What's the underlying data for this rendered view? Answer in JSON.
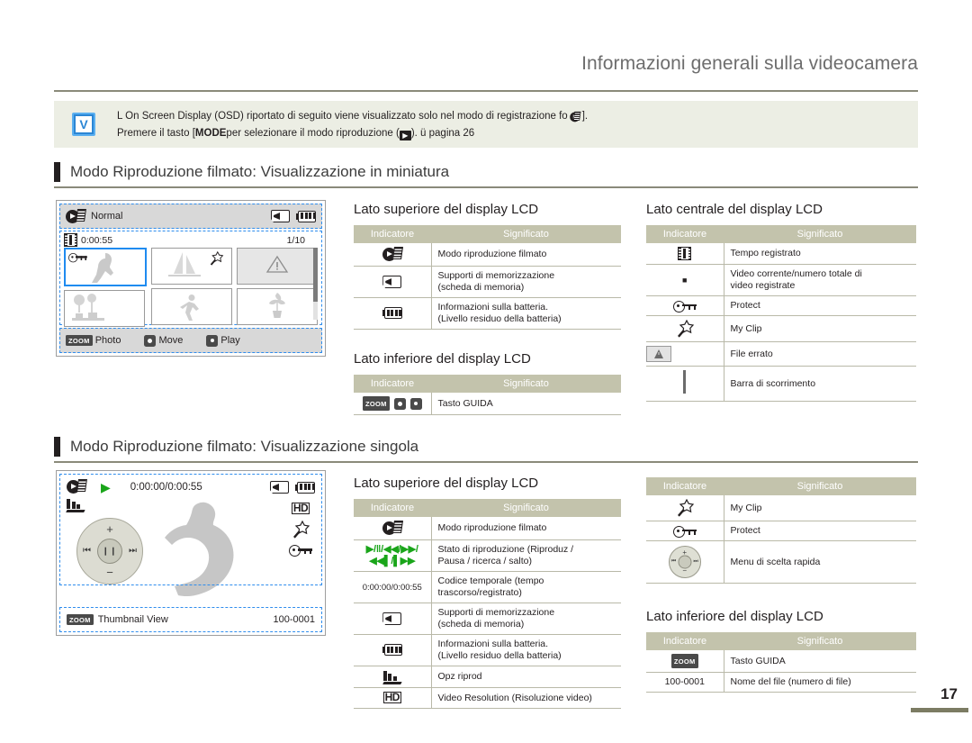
{
  "header": {
    "title": "Informazioni generali sulla videocamera"
  },
  "note": {
    "icon": "check-box-icon",
    "line1_a": "L On Screen Display (OSD) riportato di seguito viene visualizzato solo nel modo di registrazione fo",
    "line1_b": "].",
    "line2_a": "Premere il tasto [",
    "line2_kbd": "MODE",
    "line2_b": "per selezionare il modo riproduzione (",
    "line2_c": "). ü pagina 26"
  },
  "sections": [
    {
      "id": "thumbnail",
      "title": "Modo Riproduzione filmato: Visualizzazione in miniatura"
    },
    {
      "id": "single",
      "title": "Modo Riproduzione filmato: Visualizzazione singola"
    }
  ],
  "subheads": {
    "top_lcd": "Lato superiore del display LCD",
    "center_lcd": "Lato centrale del display LCD",
    "bottom_lcd": "Lato inferiore del display LCD"
  },
  "table_headers": {
    "indicator": "Indicatore",
    "meaning": "Significato"
  },
  "lcd_thumbnail": {
    "mode_label": "Normal",
    "time": "0:00:55",
    "counter": "1/10",
    "guide": [
      {
        "key": "ZOOM",
        "label": "Photo"
      },
      {
        "key": "dpad",
        "label": "Move"
      },
      {
        "key": "dpad",
        "label": "Play"
      }
    ]
  },
  "lcd_single": {
    "timecode": "0:00:00/0:00:55",
    "resolution": "HD",
    "guide_key": "ZOOM",
    "guide_label": "Thumbnail View",
    "file_name": "100-0001"
  },
  "tables": {
    "thumb_top": [
      {
        "icon": "movie-play-icon",
        "meaning_1": "Modo riproduzione filmato",
        "meaning_2": ""
      },
      {
        "icon": "memory-card-icon",
        "meaning_1": "Supporti di memorizzazione",
        "meaning_2": "(scheda di memoria)"
      },
      {
        "icon": "battery-icon",
        "meaning_1": "Informazioni sulla batteria.",
        "meaning_2": "(Livello residuo della batteria)"
      }
    ],
    "thumb_bottom": [
      {
        "icon": "guide-buttons-icon",
        "meaning_1": "Tasto GUIDA",
        "meaning_2": ""
      }
    ],
    "thumb_center": [
      {
        "icon": "film-time-icon",
        "meaning_1": "Tempo registrato",
        "meaning_2": ""
      },
      {
        "icon": "counter-icon",
        "meaning_1": "Video corrente/numero totale di",
        "meaning_2": "video registrate"
      },
      {
        "icon": "protect-key-icon",
        "meaning_1": "Protect",
        "meaning_2": ""
      },
      {
        "icon": "my-clip-icon",
        "meaning_1": "My Clip",
        "meaning_2": ""
      },
      {
        "icon": "error-file-icon",
        "meaning_1": "File errato",
        "meaning_2": ""
      },
      {
        "icon": "scroll-bar-icon",
        "meaning_1": "Barra di scorrimento",
        "meaning_2": ""
      }
    ],
    "single_top": [
      {
        "icon": "movie-play-icon",
        "meaning_1": "Modo riproduzione filmato",
        "meaning_2": ""
      },
      {
        "icon": "playback-state-icon",
        "icon_text_1": "▶/‖/◀◀/▶▶/",
        "icon_text_2": "◀◀▌/▌▶▶",
        "meaning_1": "Stato di riproduzione (Riproduz /",
        "meaning_2": "Pausa / ricerca / salto)"
      },
      {
        "icon": "timecode-text",
        "icon_text_1": "0:00:00/0:00:55",
        "meaning_1": "Codice temporale (tempo",
        "meaning_2": "trascorso/registrato)"
      },
      {
        "icon": "memory-card-icon",
        "meaning_1": "Supporti di memorizzazione",
        "meaning_2": "(scheda di memoria)"
      },
      {
        "icon": "battery-icon",
        "meaning_1": "Informazioni sulla batteria.",
        "meaning_2": "(Livello residuo della batteria)"
      },
      {
        "icon": "play-option-icon",
        "meaning_1": "Opz riprod",
        "meaning_2": ""
      },
      {
        "icon": "hd-icon",
        "meaning_1": "Video Resolution (Risoluzione video)",
        "meaning_2": ""
      }
    ],
    "single_center": [
      {
        "icon": "my-clip-icon",
        "meaning_1": "My Clip",
        "meaning_2": ""
      },
      {
        "icon": "protect-key-icon",
        "meaning_1": "Protect",
        "meaning_2": ""
      },
      {
        "icon": "quick-menu-dial-icon",
        "meaning_1": "Menu di scelta rapida",
        "meaning_2": ""
      }
    ],
    "single_bottom": [
      {
        "icon": "zoom-guide-icon",
        "meaning_1": "Tasto GUIDA",
        "meaning_2": ""
      },
      {
        "icon": "file-number-text",
        "icon_text_1": "100-0001",
        "meaning_1": "Nome del file (numero di file)",
        "meaning_2": ""
      }
    ]
  },
  "page_number": "17",
  "colors": {
    "table_header_bg": "#c3c3ac",
    "rule": "#8a8a7a",
    "note_bg": "#eceee4",
    "accent_blue": "#2f8ded",
    "green": "#1aa51a"
  }
}
